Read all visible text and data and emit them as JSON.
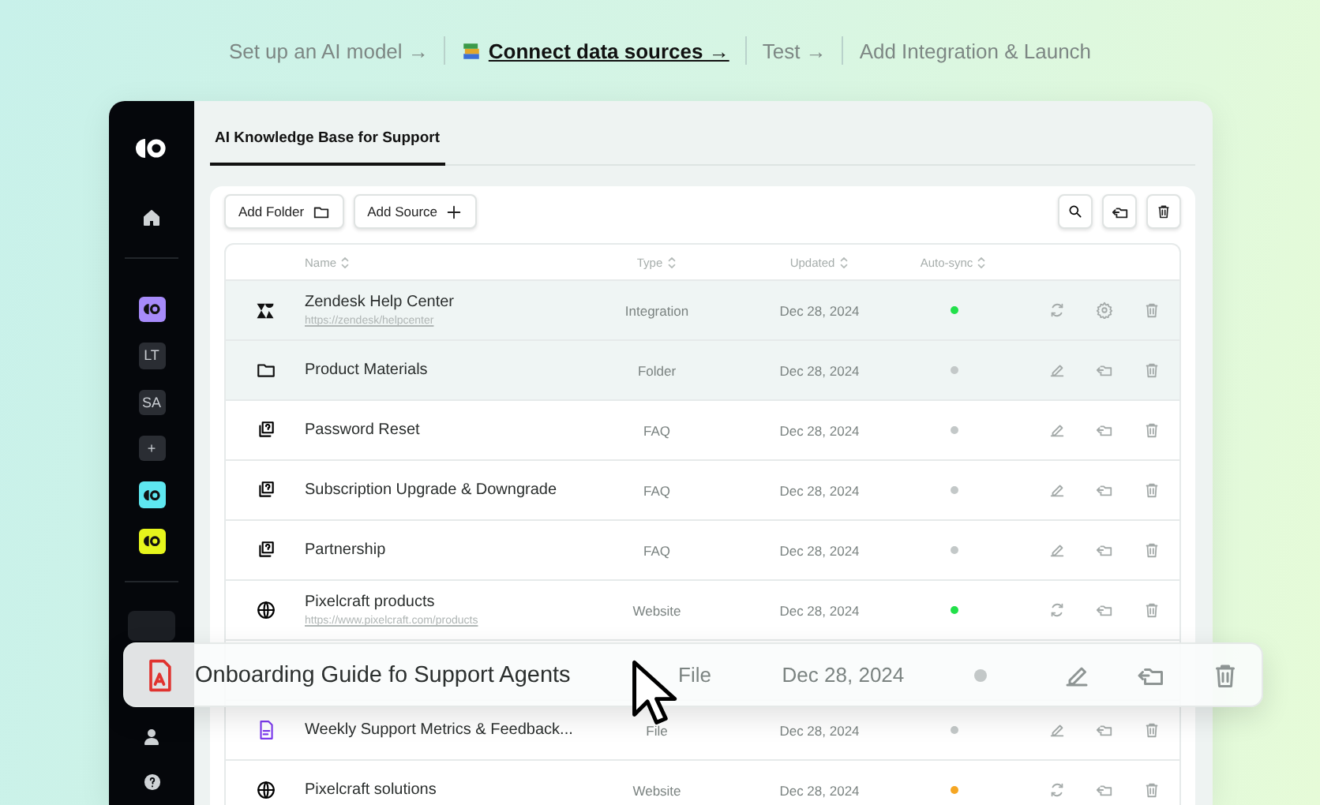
{
  "steps": [
    {
      "label": "Set up an AI model →",
      "selected": false
    },
    {
      "label": "Connect data sources →",
      "selected": true
    },
    {
      "label": "Test →",
      "selected": false
    },
    {
      "label": "Add Integration & Launch",
      "selected": false
    }
  ],
  "sidebar": {
    "workspaces": [
      {
        "kind": "logo",
        "color": "#a78bfa"
      },
      {
        "kind": "initials",
        "label": "LT",
        "color": "#2a2d33"
      },
      {
        "kind": "initials",
        "label": "SA",
        "color": "#2a2d33"
      },
      {
        "kind": "add",
        "label": "+",
        "color": "#2a2d33"
      },
      {
        "kind": "logo",
        "color": "#5ee7f0"
      },
      {
        "kind": "logo",
        "color": "#e6f51c"
      }
    ]
  },
  "tabs": [
    {
      "label": "AI Knowledge Base for Support",
      "selected": true
    }
  ],
  "toolbar": {
    "buttons": [
      {
        "label": "Add Folder",
        "kind": "folder"
      },
      {
        "label": "Add Source",
        "kind": "plus"
      }
    ]
  },
  "table": {
    "columns": [
      "Name",
      "Type",
      "Updated",
      "Auto-sync"
    ],
    "rows": [
      {
        "kind": "integration",
        "name": "Zendesk Help Center",
        "url": "https://zendesk/helpcenter",
        "type": "Integration",
        "updated": "Dec 28, 2024",
        "color": "#22e04a",
        "selected": true
      },
      {
        "kind": "folder",
        "name": "Product Materials",
        "type": "Folder",
        "updated": "Dec 28, 2024",
        "color": "#c3c8c8",
        "selected": true
      },
      {
        "kind": "faq",
        "name": "Password Reset",
        "type": "FAQ",
        "updated": "Dec 28, 2024",
        "color": "#c3c8c8",
        "selected": false
      },
      {
        "kind": "faq",
        "name": "Subscription Upgrade & Downgrade",
        "type": "FAQ",
        "updated": "Dec 28, 2024",
        "color": "#c3c8c8",
        "selected": false
      },
      {
        "kind": "faq",
        "name": "Partnership",
        "type": "FAQ",
        "updated": "Dec 28, 2024",
        "color": "#c3c8c8",
        "selected": false
      },
      {
        "kind": "website",
        "name": "Pixelcraft products",
        "url": "https://www.pixelcraft.com/products",
        "type": "Website",
        "updated": "Dec 28, 2024",
        "color": "#22e04a",
        "selected": false
      },
      {
        "kind": "gap"
      },
      {
        "kind": "file",
        "name": "Weekly Support Metrics & Feedback...",
        "type": "File",
        "updated": "Dec 28, 2024",
        "color": "#c3c8c8",
        "selected": false
      },
      {
        "kind": "website",
        "name": "Pixelcraft solutions",
        "type": "Website",
        "updated": "Dec 28, 2024",
        "color": "#f5a623",
        "selected": false
      }
    ]
  },
  "dragged_row": {
    "kind": "pdf",
    "name": "Onboarding Guide fo Support Agents",
    "type": "File",
    "updated": "Dec 28, 2024",
    "color": "#c3c8c8"
  }
}
